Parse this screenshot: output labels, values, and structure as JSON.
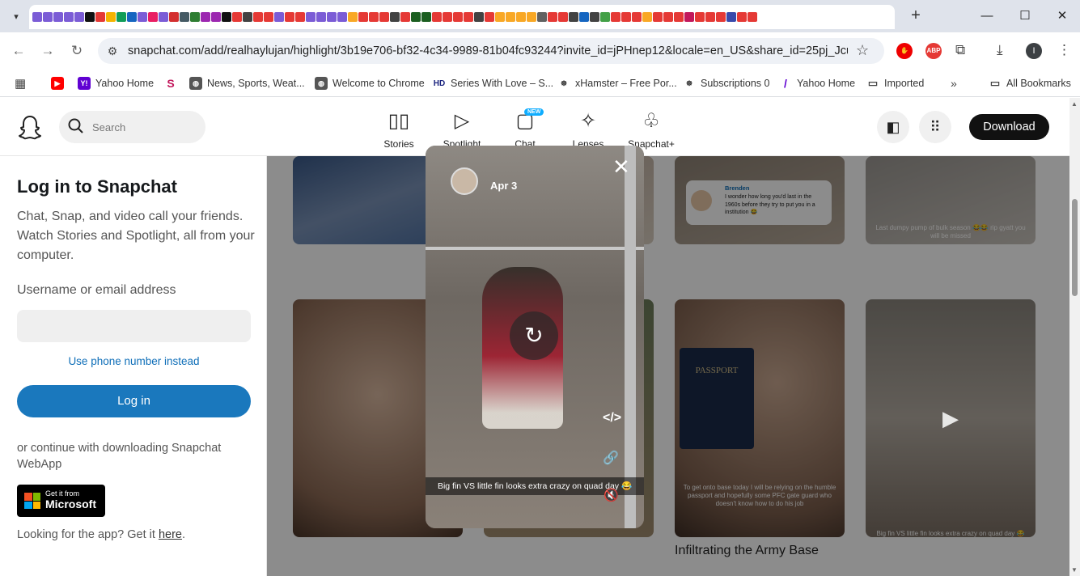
{
  "browser": {
    "url": "snapchat.com/add/realhaylujan/highlight/3b19e706-bf32-4c34-9989-81b04fc93244?invite_id=jPHnep12&locale=en_US&share_id=25pj_JcuQ...",
    "profile_initial": "I",
    "ext_abp": "ABP"
  },
  "bookmarks": [
    {
      "label": "Yahoo Home",
      "icon": "yahoo-icon"
    },
    {
      "label": "News, Sports, Weat...",
      "icon": "globe-icon"
    },
    {
      "label": "Welcome to Chrome",
      "icon": "globe-icon"
    },
    {
      "label": "Series With Love – S...",
      "icon": "hd-icon"
    },
    {
      "label": "xHamster – Free Por...",
      "icon": "xh-icon"
    },
    {
      "label": "Subscriptions 0",
      "icon": "xh-icon"
    },
    {
      "label": "Yahoo Home",
      "icon": "yahoo-icon"
    },
    {
      "label": "Imported",
      "icon": "folder-icon"
    },
    {
      "label": "All Bookmarks",
      "icon": "folder-icon"
    }
  ],
  "header": {
    "search_placeholder": "Search",
    "nav": [
      {
        "label": "Stories",
        "icon": "stories-icon"
      },
      {
        "label": "Spotlight",
        "icon": "play-icon"
      },
      {
        "label": "Chat",
        "icon": "chat-icon"
      },
      {
        "label": "Lenses",
        "icon": "lens-icon"
      },
      {
        "label": "Snapchat+",
        "icon": "ghost-plus-icon"
      }
    ],
    "chat_badge": "NEW",
    "download_label": "Download"
  },
  "login": {
    "title": "Log in to Snapchat",
    "subtitle": "Chat, Snap, and video call your friends. Watch Stories and Spotlight, all from your computer.",
    "field_label": "Username or email address",
    "phone_link": "Use phone number instead",
    "login_button": "Log in",
    "continue_text": "or continue with downloading Snapchat WebApp",
    "ms_small": "Get it from",
    "ms_big": "Microsoft",
    "looking_text": "Looking for the app? Get it",
    "here_link": "here",
    "period": "."
  },
  "tiles": {
    "t3_name": "Brenden",
    "t3_text": "I wonder how long you'd last in the 1960s before they try to put you in a institution 😂",
    "t4_caption": "Last dumpy pump of bulk season 😂😂 rip gyatt you will be missed",
    "t7_caption": "To get onto base today I will be relying on the humble passport and hopefully some PFC gate guard who doesn't know how to do his job",
    "t7_passport": "PASSPORT",
    "t8_caption": "Big fin VS little fin looks extra crazy on quad day 😂",
    "t7_title": "Infiltrating the Army Base"
  },
  "story": {
    "date": "Apr 3",
    "caption": "Big fin VS little fin looks extra crazy on quad day 😂"
  }
}
